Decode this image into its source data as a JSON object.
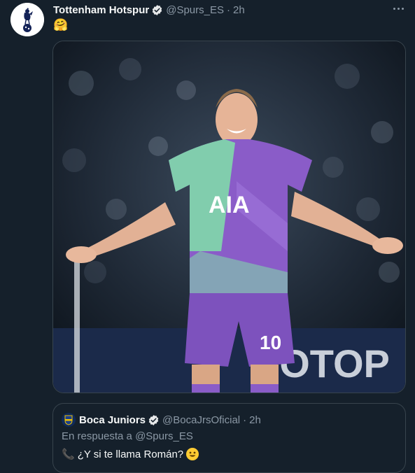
{
  "tweet": {
    "author_name": "Tottenham Hotspur",
    "handle": "@Spurs_ES",
    "separator": "·",
    "time": "2h",
    "text_emoji": "🤗",
    "photo": {
      "jersey_sponsor": "AIA",
      "shirt_number": "10",
      "board_text": "TOTOP"
    }
  },
  "quote": {
    "author_name": "Boca Juniors",
    "handle": "@BocaJrsOficial",
    "separator": "·",
    "time": "2h",
    "reply_prefix": "En respuesta a",
    "reply_mention": "@Spurs_ES",
    "text": "¿Y si te llama Román?",
    "text_icon": "📞"
  },
  "colors": {
    "background": "#15202b",
    "verified": "#e7e9ea",
    "muted_text": "#8b98a5",
    "border": "#38444d",
    "kit_purple": "#8a5cc8",
    "kit_green": "#7fe0a8"
  },
  "icons": [
    "spurs-crest-icon",
    "verified-icon",
    "more-icon",
    "boca-crest-icon",
    "phone-icon",
    "smiling-face-icon"
  ]
}
